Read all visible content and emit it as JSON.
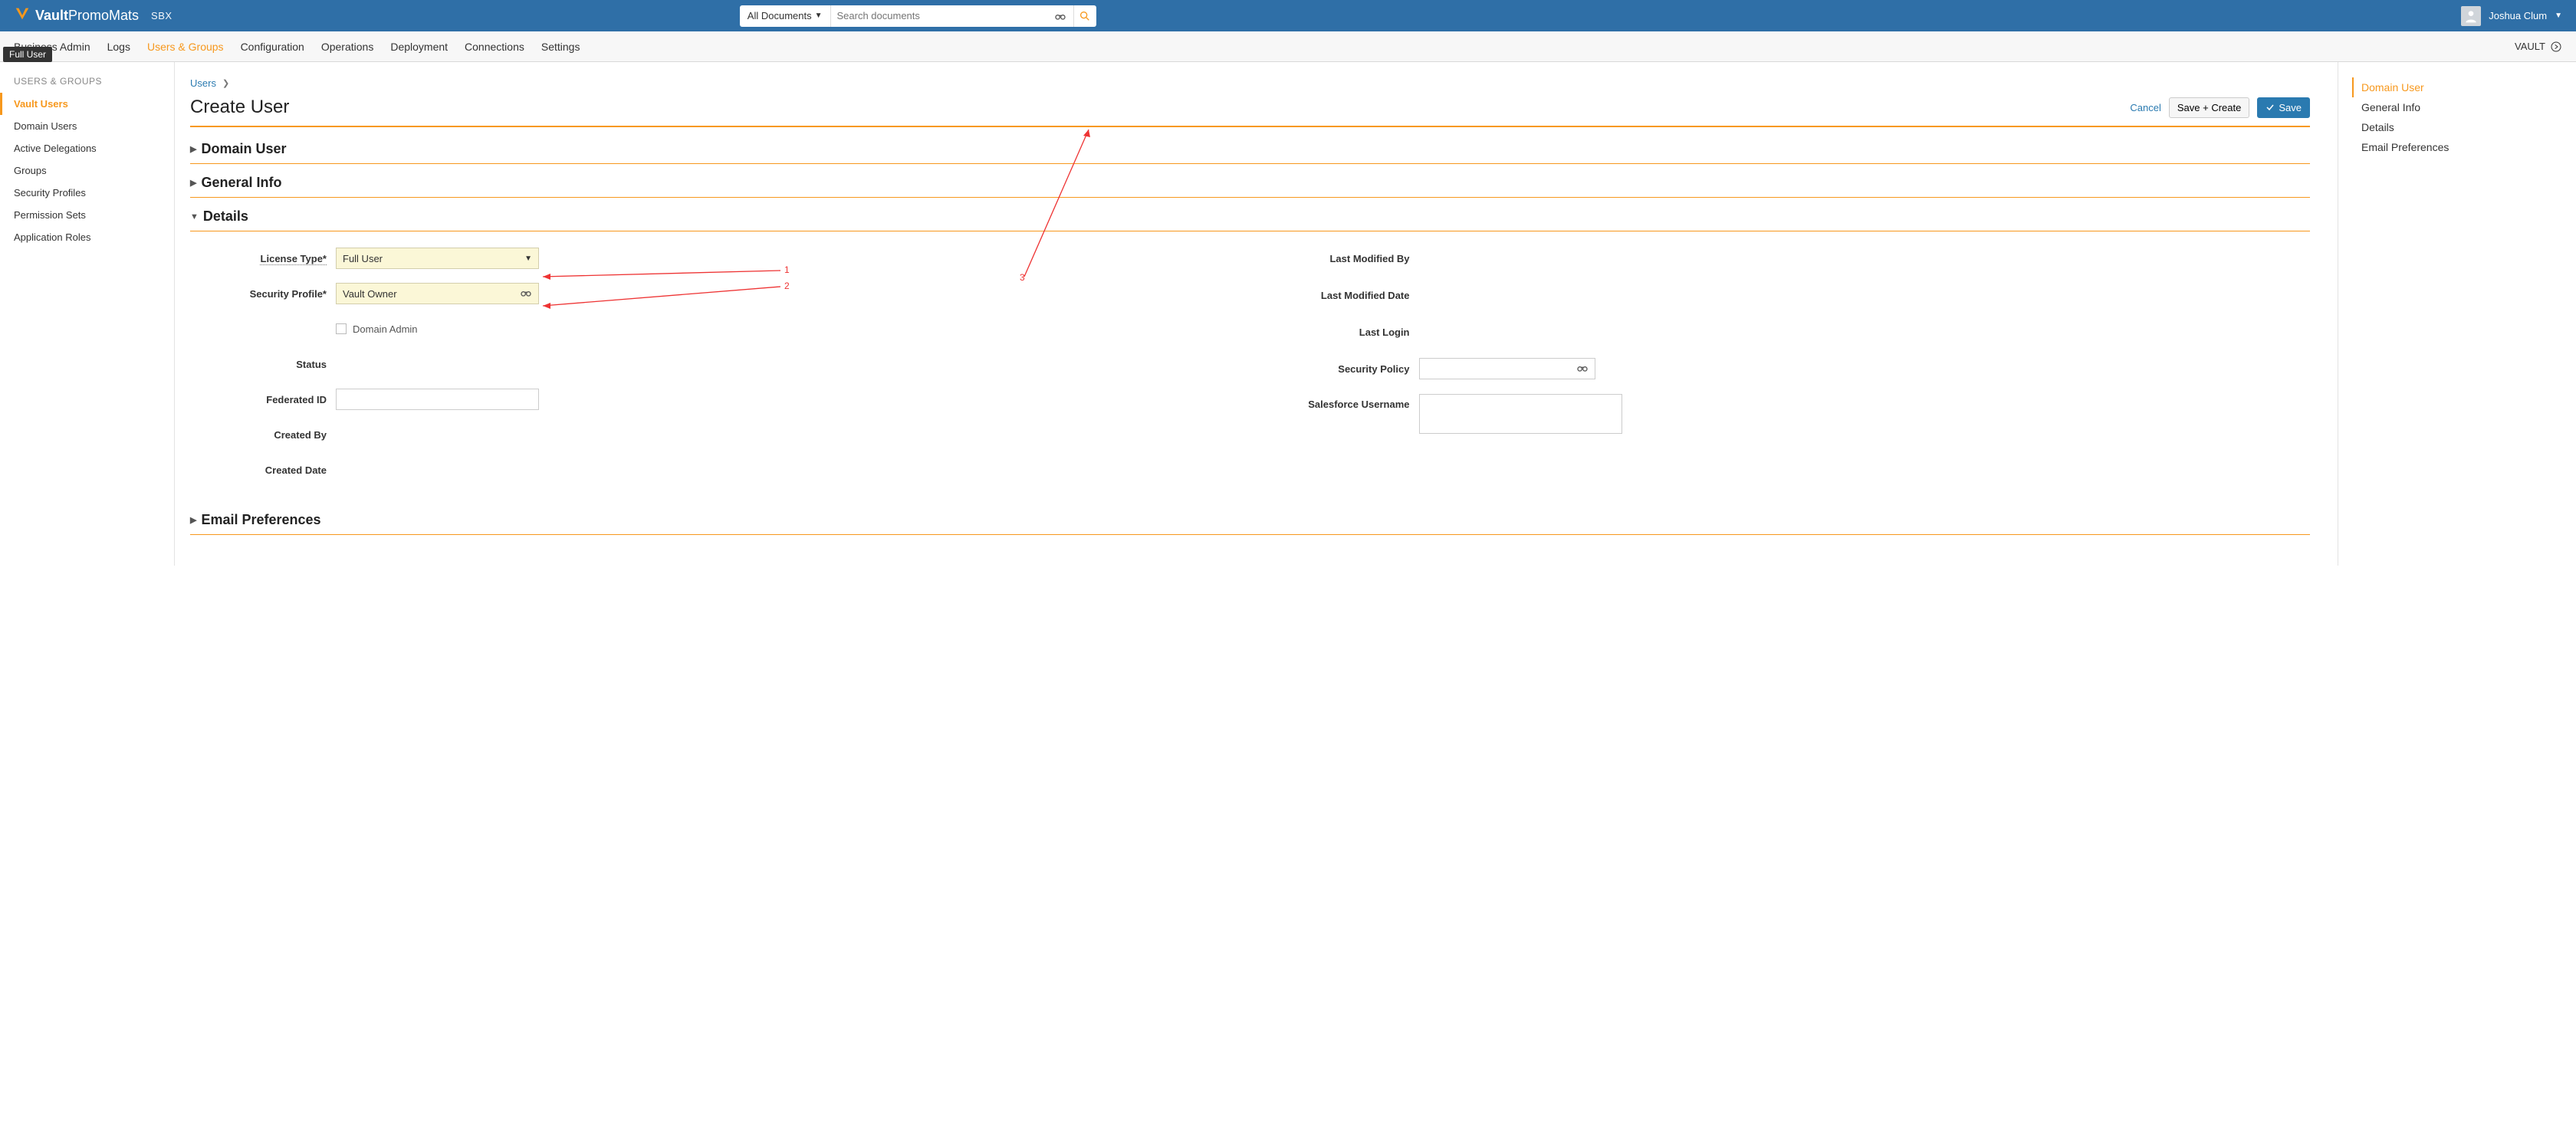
{
  "brand": {
    "name_bold": "Vault",
    "name_light": "PromoMats",
    "env": "SBX"
  },
  "search": {
    "scope": "All Documents",
    "placeholder": "Search documents"
  },
  "user": {
    "name": "Joshua Clum"
  },
  "nav": {
    "items": [
      "Business Admin",
      "Logs",
      "Users & Groups",
      "Configuration",
      "Operations",
      "Deployment",
      "Connections",
      "Settings"
    ],
    "active_index": 2,
    "vault_link": "VAULT"
  },
  "tooltip": "Full User",
  "sidebar": {
    "title": "USERS & GROUPS",
    "items": [
      "Vault Users",
      "Domain Users",
      "Active Delegations",
      "Groups",
      "Security Profiles",
      "Permission Sets",
      "Application Roles"
    ],
    "active_index": 0
  },
  "breadcrumb": {
    "root": "Users"
  },
  "page": {
    "title": "Create User"
  },
  "actions": {
    "cancel": "Cancel",
    "save_create": "Save + Create",
    "save": "Save"
  },
  "sections": {
    "domain_user": "Domain User",
    "general_info": "General Info",
    "details": "Details",
    "email_prefs": "Email Preferences"
  },
  "details": {
    "left": {
      "license_type_label": "License Type*",
      "license_type_value": "Full User",
      "security_profile_label": "Security Profile*",
      "security_profile_value": "Vault Owner",
      "domain_admin_label": "Domain Admin",
      "status_label": "Status",
      "federated_id_label": "Federated ID",
      "created_by_label": "Created By",
      "created_date_label": "Created Date"
    },
    "right": {
      "last_modified_by_label": "Last Modified By",
      "last_modified_date_label": "Last Modified Date",
      "last_login_label": "Last Login",
      "security_policy_label": "Security Policy",
      "salesforce_username_label": "Salesforce Username"
    }
  },
  "toc": {
    "items": [
      "Domain User",
      "General Info",
      "Details",
      "Email Preferences"
    ],
    "active_index": 0
  },
  "annotations": {
    "n1": "1",
    "n2": "2",
    "n3": "3"
  }
}
